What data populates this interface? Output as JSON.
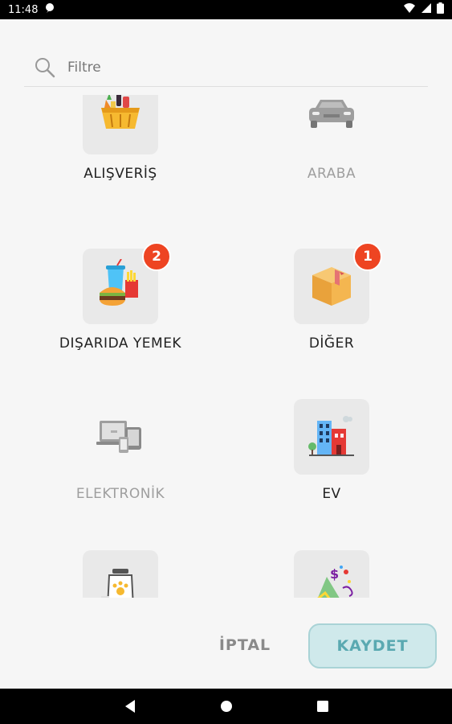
{
  "status_bar": {
    "time": "11:48"
  },
  "filter": {
    "placeholder": "Filtre",
    "value": ""
  },
  "categories": [
    {
      "label": "ALIŞVERİŞ",
      "icon": "shopping-basket-icon",
      "disabled": false
    },
    {
      "label": "ARABA",
      "icon": "car-icon",
      "disabled": true
    },
    {
      "label": "DIŞARIDA YEMEK",
      "icon": "fast-food-icon",
      "disabled": false,
      "badge": "2"
    },
    {
      "label": "DİĞER",
      "icon": "package-box-icon",
      "disabled": false,
      "badge": "1"
    },
    {
      "label": "ELEKTRONİK",
      "icon": "electronics-devices-icon",
      "disabled": true
    },
    {
      "label": "EV",
      "icon": "house-building-icon",
      "disabled": false
    },
    {
      "label": "",
      "icon": "pet-food-jar-icon",
      "disabled": false
    },
    {
      "label": "",
      "icon": "party-confetti-icon",
      "disabled": false
    }
  ],
  "actions": {
    "cancel_label": "İPTAL",
    "save_label": "KAYDET"
  },
  "colors": {
    "badge": "#ee4422",
    "save_bg": "#cfe9eb",
    "save_text": "#5aa9b1",
    "disabled_text": "#9e9e9e"
  }
}
